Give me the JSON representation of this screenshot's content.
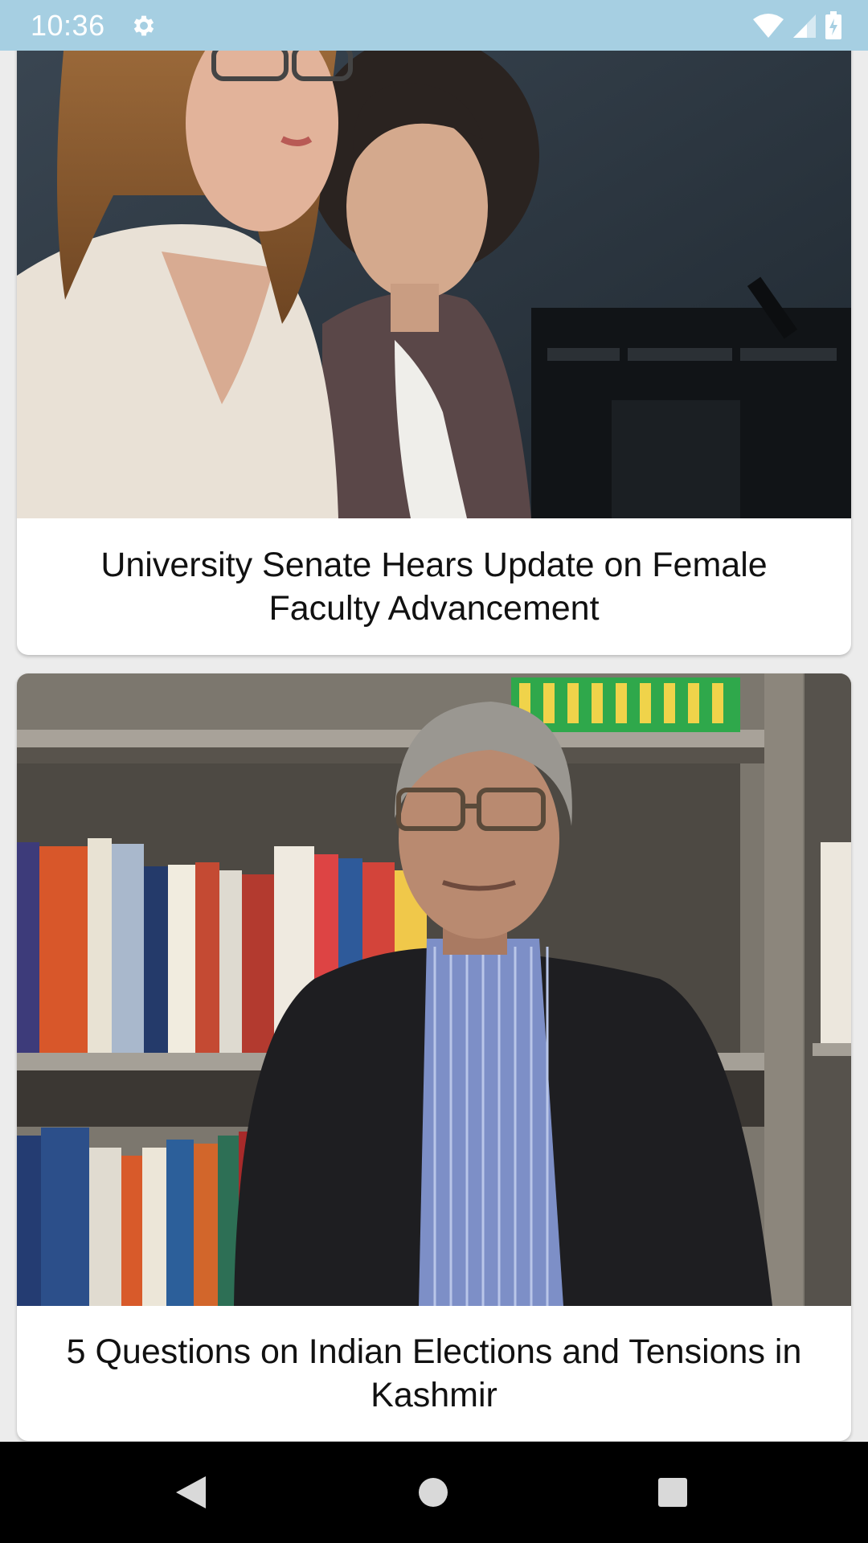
{
  "status_bar": {
    "time": "10:36",
    "icons": [
      "gear-icon",
      "wifi-icon",
      "cellular-signal-icon",
      "battery-icon"
    ]
  },
  "feed": {
    "articles": [
      {
        "title": "University Senate Hears Update on Female Faculty Advancement",
        "image": "photo-two-women-at-meeting"
      },
      {
        "title": "5 Questions on Indian Elections and Tensions in Kashmir",
        "image": "photo-man-in-front-of-bookshelf"
      }
    ]
  },
  "nav_bar": {
    "icons": [
      "back-icon",
      "home-icon",
      "recents-icon"
    ]
  },
  "colors": {
    "status_bar": "#a6cfe2",
    "card_background": "#ffffff",
    "nav_bar": "#000000"
  }
}
